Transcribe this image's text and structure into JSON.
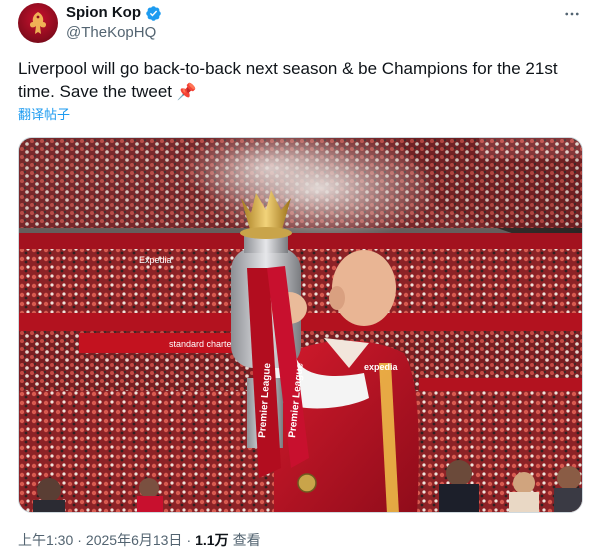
{
  "author": {
    "display_name": "Spion Kop",
    "handle": "@TheKopHQ",
    "verified": true
  },
  "icons": {
    "avatar": "liverbird-avatar",
    "verified": "verified-badge-icon",
    "more": "more-dots-icon",
    "pin": "pushpin-emoji"
  },
  "tweet": {
    "text": "Liverpool will go back-to-back next season & be Champions for the 21st time. Save the tweet ",
    "emoji": "📌",
    "translate_label": "翻译帖子"
  },
  "media": {
    "banner_text_1": "Expedia",
    "banner_text_2": "standard chartered",
    "sash_text": "Premier League",
    "shirt_sponsor": "expedia"
  },
  "meta": {
    "time": "上午1:30",
    "sep1": "·",
    "date": "2025年6月13日",
    "sep2": "·",
    "views": "1.1万",
    "views_label": "查看"
  },
  "colors": {
    "accent": "#1d9bf0",
    "text_secondary": "#536471",
    "liverpool_red": "#c8102e"
  }
}
